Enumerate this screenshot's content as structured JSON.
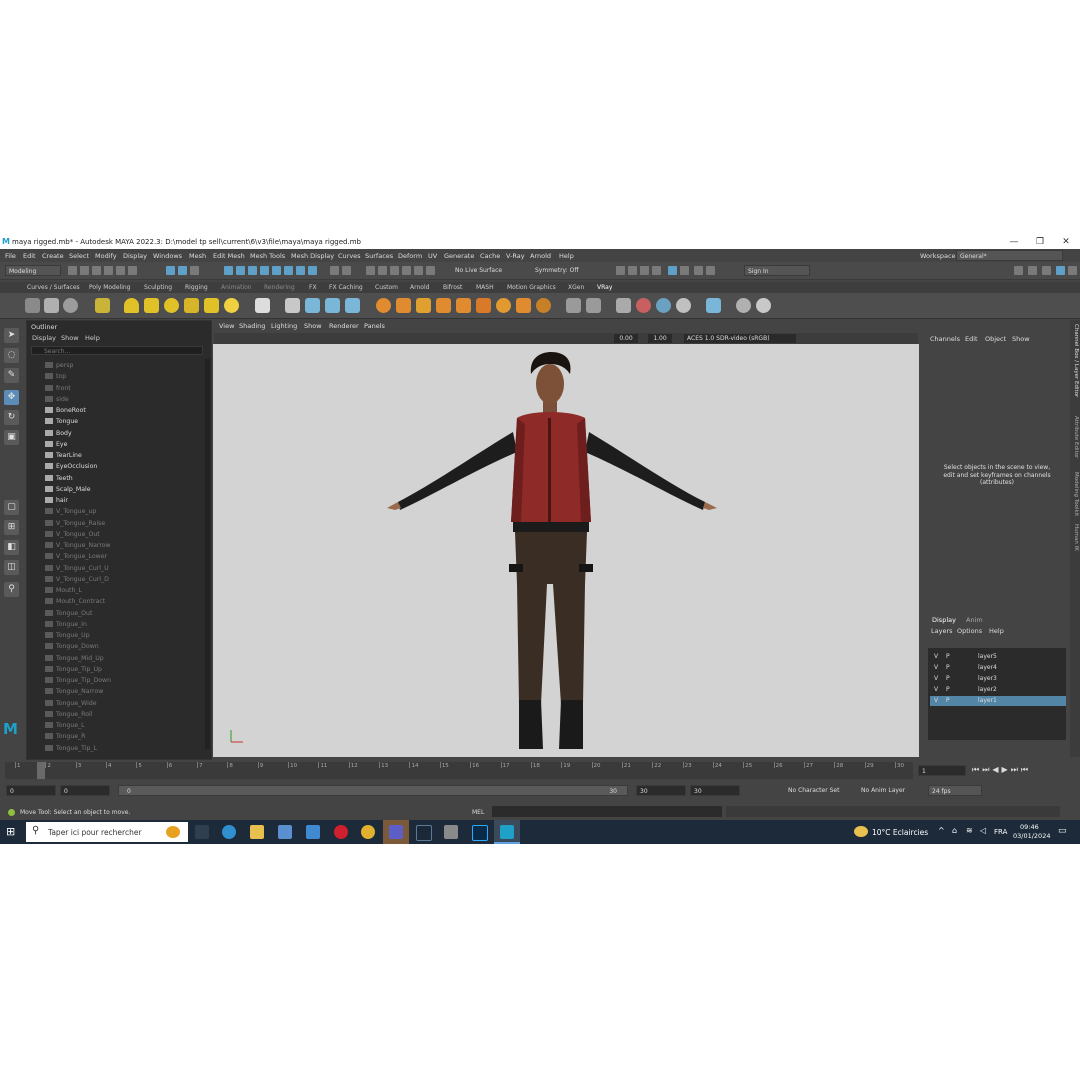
{
  "window": {
    "title": "maya rigged.mb* - Autodesk MAYA 2022.3: D:\\model tp sell\\current\\6\\v3\\file\\maya\\maya rigged.mb",
    "logo": "M",
    "minimize": "—",
    "restore": "❐",
    "close": "✕"
  },
  "menubar": {
    "items": [
      "File",
      "Edit",
      "Create",
      "Select",
      "Modify",
      "Display",
      "Windows",
      "Mesh",
      "Edit Mesh",
      "Mesh Tools",
      "Mesh Display",
      "Curves",
      "Surfaces",
      "Deform",
      "UV",
      "Generate",
      "Cache",
      "V-Ray",
      "Arnold",
      "Help"
    ],
    "workspace_label": "Workspace:",
    "workspace_value": "General*"
  },
  "statusline": {
    "mode": "Modeling",
    "live_surface": "No Live Surface",
    "symmetry": "Symmetry: Off",
    "sign_in": "Sign In"
  },
  "shelf": {
    "tabs": [
      "Curves / Surfaces",
      "Poly Modeling",
      "Sculpting",
      "Rigging",
      "Animation",
      "Rendering",
      "FX",
      "FX Caching",
      "Custom",
      "Arnold",
      "Bifrost",
      "MASH",
      "Motion Graphics",
      "XGen",
      "VRay"
    ],
    "active_tab": "VRay"
  },
  "outliner": {
    "title": "Outliner",
    "menu": [
      "Display",
      "Show",
      "Help"
    ],
    "search_placeholder": "Search...",
    "items": [
      {
        "label": "persp",
        "dim": true
      },
      {
        "label": "top",
        "dim": true
      },
      {
        "label": "front",
        "dim": true
      },
      {
        "label": "side",
        "dim": true
      },
      {
        "label": "BoneRoot",
        "dim": false
      },
      {
        "label": "Tongue",
        "dim": false
      },
      {
        "label": "Body",
        "dim": false
      },
      {
        "label": "Eye",
        "dim": false
      },
      {
        "label": "TearLine",
        "dim": false
      },
      {
        "label": "EyeOcclusion",
        "dim": false
      },
      {
        "label": "Teeth",
        "dim": false
      },
      {
        "label": "Scalp_Male",
        "dim": false
      },
      {
        "label": "hair",
        "dim": false
      },
      {
        "label": "V_Tongue_up",
        "dim": true
      },
      {
        "label": "V_Tongue_Raise",
        "dim": true
      },
      {
        "label": "V_Tongue_Out",
        "dim": true
      },
      {
        "label": "V_Tongue_Narrow",
        "dim": true
      },
      {
        "label": "V_Tongue_Lower",
        "dim": true
      },
      {
        "label": "V_Tongue_Curl_U",
        "dim": true
      },
      {
        "label": "V_Tongue_Curl_D",
        "dim": true
      },
      {
        "label": "Mouth_L",
        "dim": true
      },
      {
        "label": "Mouth_Contract",
        "dim": true
      },
      {
        "label": "Tongue_Out",
        "dim": true
      },
      {
        "label": "Tongue_In",
        "dim": true
      },
      {
        "label": "Tongue_Up",
        "dim": true
      },
      {
        "label": "Tongue_Down",
        "dim": true
      },
      {
        "label": "Tongue_Mid_Up",
        "dim": true
      },
      {
        "label": "Tongue_Tip_Up",
        "dim": true
      },
      {
        "label": "Tongue_Tip_Down",
        "dim": true
      },
      {
        "label": "Tongue_Narrow",
        "dim": true
      },
      {
        "label": "Tongue_Wide",
        "dim": true
      },
      {
        "label": "Tongue_Roll",
        "dim": true
      },
      {
        "label": "Tongue_L",
        "dim": true
      },
      {
        "label": "Tongue_R",
        "dim": true
      },
      {
        "label": "Tongue_Tip_L",
        "dim": true
      }
    ]
  },
  "viewport": {
    "menu": [
      "View",
      "Shading",
      "Lighting",
      "Show",
      "Renderer",
      "Panels"
    ],
    "exposure": "0.00",
    "gamma": "1.00",
    "color_space": "ACES 1.0 SDR-video (sRGB)",
    "background": "#d3d3d3"
  },
  "channelbox": {
    "menu": [
      "Channels",
      "Edit",
      "Object",
      "Show"
    ],
    "hint": "Select objects in the scene to view, edit and set keyframes on channels (attributes)"
  },
  "layereditor": {
    "tabs": [
      "Display",
      "Anim"
    ],
    "menu": [
      "Layers",
      "Options",
      "Help"
    ],
    "layers": [
      {
        "v": "V",
        "p": "P",
        "name": "layer5",
        "selected": false
      },
      {
        "v": "V",
        "p": "P",
        "name": "layer4",
        "selected": false
      },
      {
        "v": "V",
        "p": "P",
        "name": "layer3",
        "selected": false
      },
      {
        "v": "V",
        "p": "P",
        "name": "layer2",
        "selected": false
      },
      {
        "v": "V",
        "p": "P",
        "name": "layer1",
        "selected": true
      }
    ]
  },
  "sidetabs": [
    "Channel Box / Layer Editor",
    "Attribute Editor",
    "Modeling Toolkit",
    "Human IK"
  ],
  "timeslider": {
    "ticks": [
      "1",
      "2",
      "3",
      "4",
      "5",
      "6",
      "7",
      "8",
      "9",
      "10",
      "11",
      "12",
      "13",
      "14",
      "15",
      "16",
      "17",
      "18",
      "19",
      "20",
      "21",
      "22",
      "23",
      "24",
      "25",
      "26",
      "27",
      "28",
      "29",
      "30"
    ],
    "current_frame": "1"
  },
  "rangebar": {
    "start": "0",
    "anim_start": "0",
    "range_start": "0",
    "range_end": "30",
    "playback_end": "30",
    "anim_end": "30",
    "character_set": "No Character Set",
    "anim_layer": "No Anim Layer",
    "fps": "24 fps"
  },
  "helpline": {
    "message": "Move Tool: Select an object to move.",
    "mel": "MEL"
  },
  "taskbar": {
    "search_placeholder": "Taper ici pour rechercher",
    "weather": "10°C  Eclaircies",
    "language": "FRA",
    "time": "09:46",
    "date": "03/01/2024"
  }
}
